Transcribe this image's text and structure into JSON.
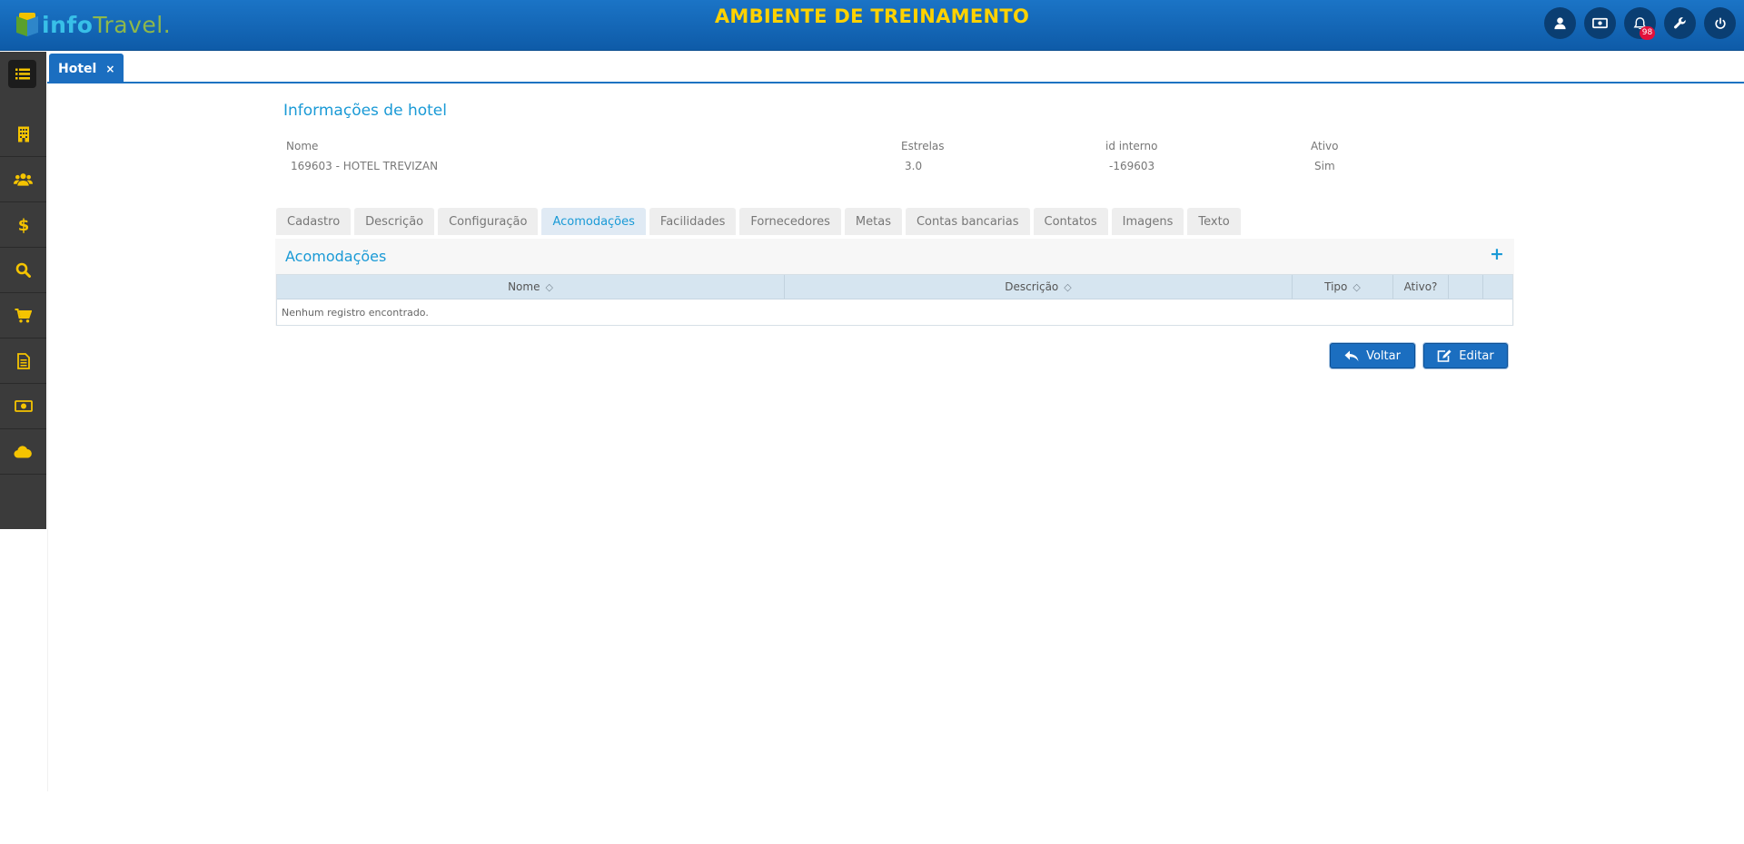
{
  "header": {
    "logo": {
      "part1": "info",
      "part2": "Travel",
      "dot": "."
    },
    "env_title": "AMBIENTE DE TREINAMENTO",
    "icons": [
      "user-icon",
      "money-icon",
      "bell-icon",
      "wrench-icon",
      "power-icon"
    ],
    "notifications_count": "98"
  },
  "sidebar": {
    "items": [
      "building-icon",
      "users-icon",
      "dollar-icon",
      "search-icon",
      "cart-icon",
      "document-icon",
      "money-icon",
      "cloud-icon"
    ]
  },
  "open_tab": {
    "label": "Hotel",
    "close": "×"
  },
  "hotel_info": {
    "title": "Informações de hotel",
    "fields": [
      {
        "label": "Nome",
        "value": "169603 - HOTEL TREVIZAN"
      },
      {
        "label": "Estrelas",
        "value": "3.0"
      },
      {
        "label": "id interno",
        "value": "-169603"
      },
      {
        "label": "Ativo",
        "value": "Sim"
      }
    ]
  },
  "tabs": {
    "items": [
      "Cadastro",
      "Descrição",
      "Configuração",
      "Acomodações",
      "Facilidades",
      "Fornecedores",
      "Metas",
      "Contas bancarias",
      "Contatos",
      "Imagens",
      "Texto"
    ],
    "active": "Acomodações"
  },
  "accommodations": {
    "title": "Acomodações",
    "add": "+",
    "columns": [
      "Nome",
      "Descrição",
      "Tipo",
      "Ativo?"
    ],
    "empty_message": "Nenhum registro encontrado."
  },
  "actions": {
    "back": "Voltar",
    "edit": "Editar"
  },
  "colors": {
    "header_blue": "#1b74c6",
    "accent_yellow": "#ffd200",
    "sidebar_icon": "#f5c400",
    "link_blue": "#1a9ad6"
  }
}
